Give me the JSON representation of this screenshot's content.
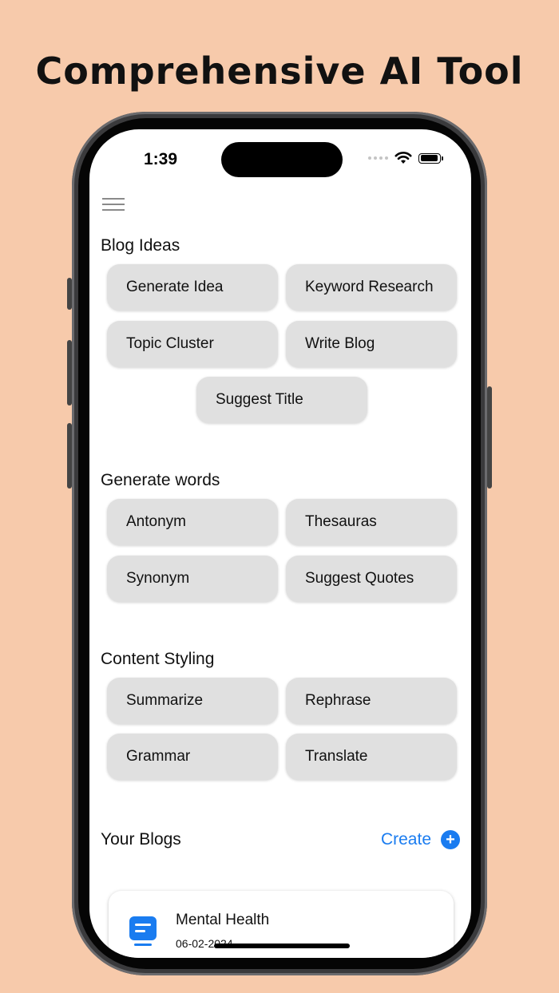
{
  "headline": "Comprehensive AI Tool",
  "status_bar": {
    "time": "1:39",
    "icons": [
      "signal-dots-icon",
      "wifi-icon",
      "battery-icon"
    ]
  },
  "menu_icon": "hamburger-menu-icon",
  "sections": {
    "blog_ideas": {
      "title": "Blog Ideas",
      "buttons": [
        "Generate Idea",
        "Keyword Research",
        "Topic Cluster",
        "Write Blog",
        "Suggest Title"
      ]
    },
    "generate_words": {
      "title": "Generate words",
      "buttons": [
        "Antonym",
        "Thesauras",
        "Synonym",
        "Suggest Quotes"
      ]
    },
    "content_styling": {
      "title": "Content Styling",
      "buttons": [
        "Summarize",
        "Rephrase",
        "Grammar",
        "Translate"
      ]
    }
  },
  "your_blogs": {
    "title": "Your Blogs",
    "create_label": "Create",
    "items": [
      {
        "title": "Mental Health",
        "date": "06-02-2024"
      }
    ]
  },
  "colors": {
    "background": "#f7caab",
    "accent": "#1a7cf0",
    "chip": "#e0e0e0"
  }
}
